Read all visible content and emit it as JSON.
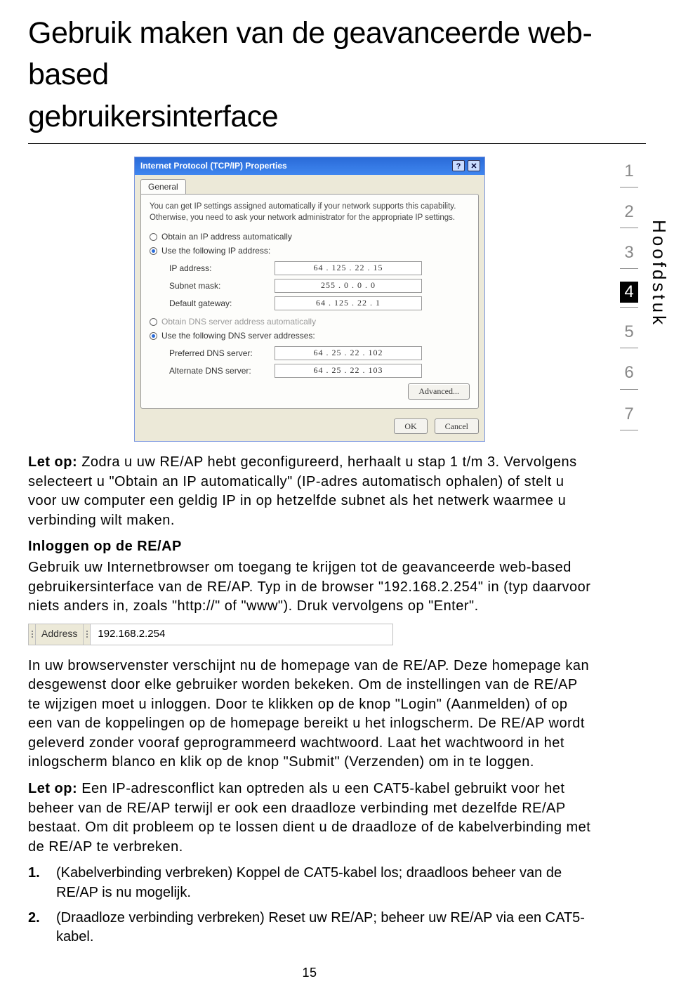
{
  "header": {
    "line1": "Gebruik maken van de geavanceerde web-based",
    "line2": "gebruikersinterface"
  },
  "sidebar": {
    "nums": [
      "1",
      "2",
      "3",
      "4",
      "5",
      "6",
      "7"
    ],
    "current_index": 3,
    "label": "Hoofdstuk"
  },
  "dialog": {
    "title": "Internet Protocol (TCP/IP) Properties",
    "help_btn": "?",
    "close_btn": "✕",
    "tab_general": "General",
    "intro": "You can get IP settings assigned automatically if your network supports this capability. Otherwise, you need to ask your network administrator for the appropriate IP settings.",
    "r_obtain_ip": "Obtain an IP address automatically",
    "r_use_ip": "Use the following IP address:",
    "lbl_ip": "IP address:",
    "val_ip": "64 . 125 . 22 . 15",
    "lbl_mask": "Subnet mask:",
    "val_mask": "255 . 0 . 0 . 0",
    "lbl_gw": "Default gateway:",
    "val_gw": "64 . 125 . 22 . 1",
    "r_obtain_dns": "Obtain DNS server address automatically",
    "r_use_dns": "Use the following DNS server addresses:",
    "lbl_pdns": "Preferred DNS server:",
    "val_pdns": "64 . 25 . 22 . 102",
    "lbl_adns": "Alternate DNS server:",
    "val_adns": "64 . 25 . 22 . 103",
    "btn_adv": "Advanced...",
    "btn_ok": "OK",
    "btn_cancel": "Cancel"
  },
  "body": {
    "letop1_label": "Let op:",
    "letop1_text": " Zodra u uw RE/AP hebt geconfigureerd, herhaalt u stap 1 t/m 3. Vervolgens selecteert u \"Obtain an IP automatically\" (IP-adres automatisch ophalen) of stelt u voor uw computer een geldig IP in op hetzelfde subnet als het netwerk waarmee u verbinding wilt maken.",
    "subhead": "Inloggen op de RE/AP",
    "para2": "Gebruik uw Internetbrowser om toegang te krijgen tot de geavanceerde web-based gebruikersinterface van de RE/AP. Typ in de browser \"192.168.2.254\" in (typ daarvoor niets anders in, zoals \"http://\" of \"www\"). Druk vervolgens op \"Enter\".",
    "address_label": "Address",
    "address_value": "192.168.2.254",
    "para3": "In uw browservenster verschijnt nu de homepage van de RE/AP. Deze homepage kan desgewenst door elke gebruiker worden bekeken. Om de instellingen van de RE/AP te wijzigen moet u inloggen. Door te klikken op de knop \"Login\" (Aanmelden) of op een van de koppelingen op de homepage bereikt u het inlogscherm. De RE/AP wordt geleverd zonder vooraf geprogrammeerd wachtwoord. Laat het wachtwoord in het inlogscherm blanco en klik op de knop \"Submit\" (Verzenden) om in te loggen.",
    "letop2_label": "Let op:",
    "letop2_text": " Een IP-adresconflict kan optreden als u een CAT5-kabel gebruikt voor het beheer van de RE/AP terwijl er ook een draadloze verbinding met dezelfde RE/AP bestaat. Om dit probleem op te lossen dient u de draadloze of de kabelverbinding met de RE/AP te verbreken.",
    "li1_num": "1.",
    "li1_text": "(Kabelverbinding verbreken) Koppel de CAT5-kabel los; draadloos beheer van de RE/AP is nu mogelijk.",
    "li2_num": "2.",
    "li2_text": "(Draadloze verbinding verbreken) Reset uw RE/AP; beheer uw RE/AP via een CAT5-kabel.",
    "page_number": "15"
  }
}
